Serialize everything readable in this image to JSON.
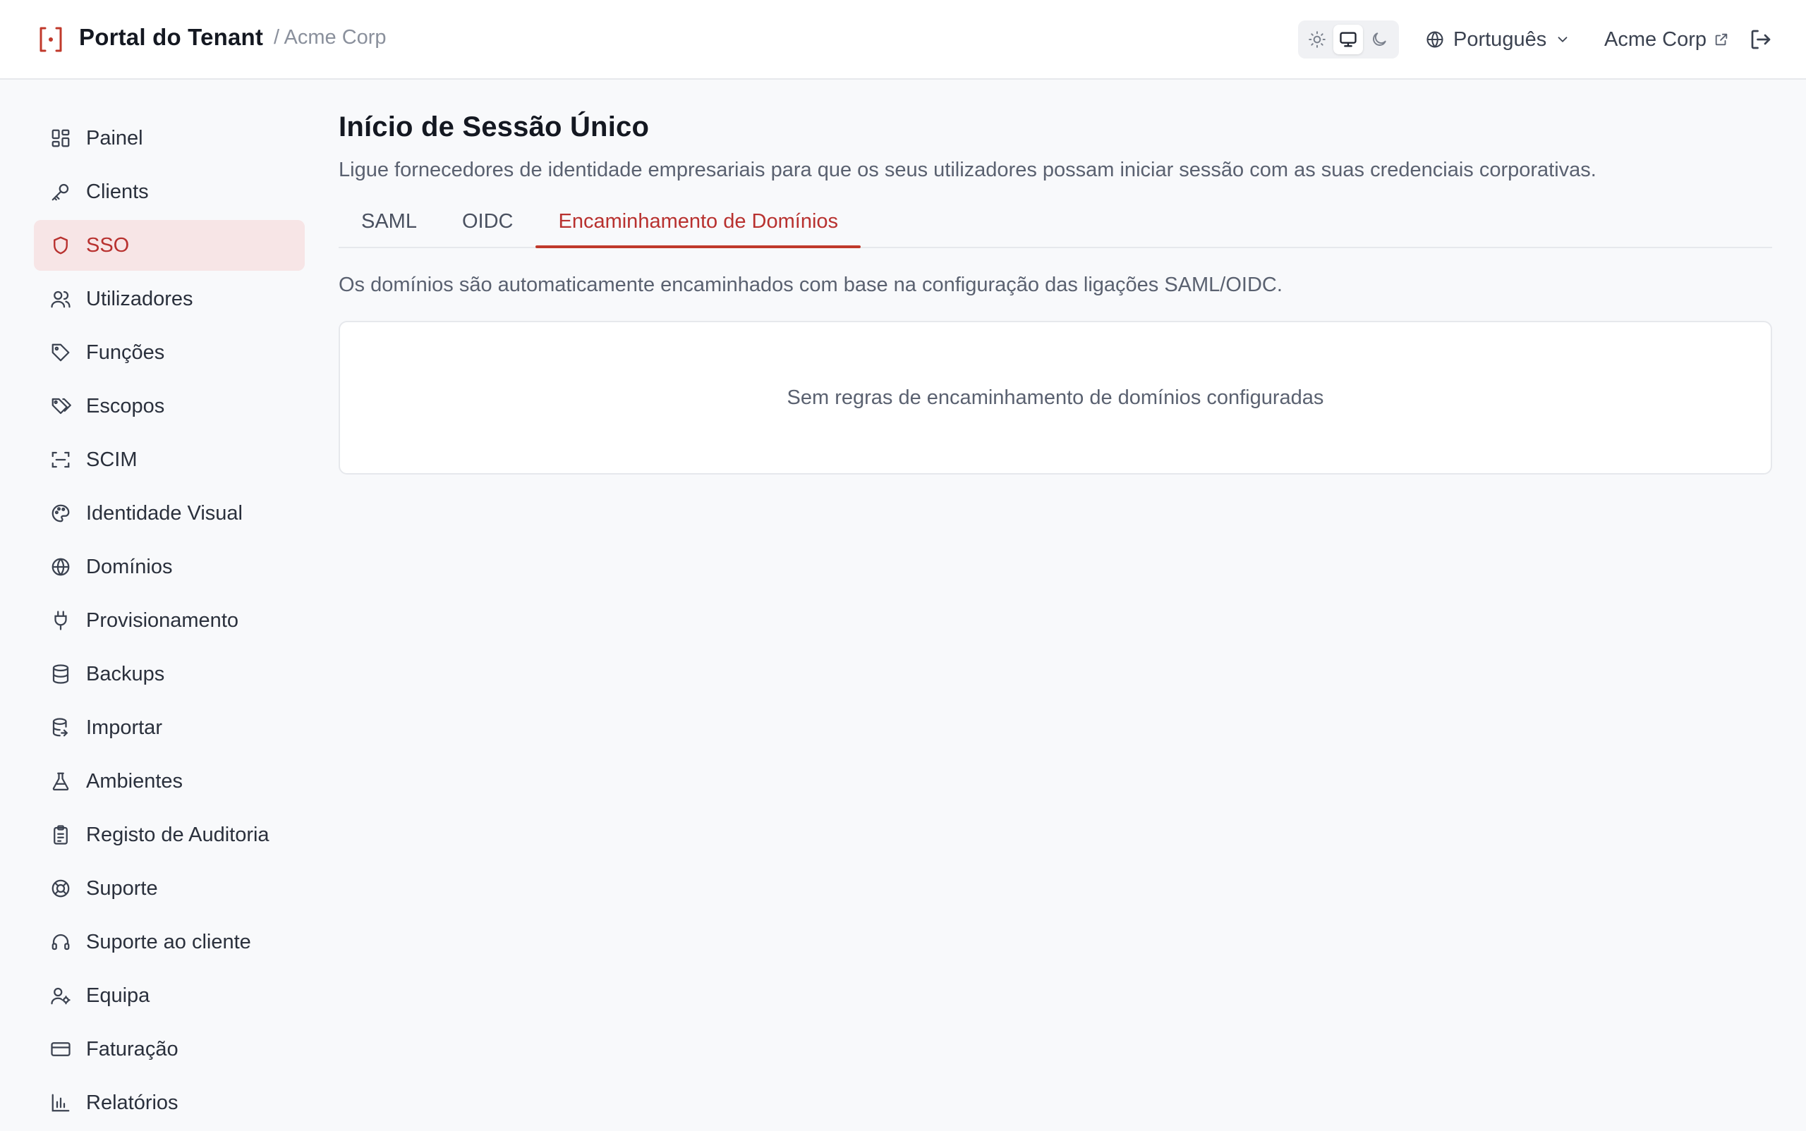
{
  "header": {
    "title": "Portal do Tenant",
    "tenant_crumb": "/ Acme Corp",
    "language": "Português",
    "tenant_link": "Acme Corp"
  },
  "sidebar": {
    "items": [
      {
        "label": "Painel",
        "icon": "dashboard-icon"
      },
      {
        "label": "Clients",
        "icon": "key-icon"
      },
      {
        "label": "SSO",
        "icon": "shield-icon",
        "active": true
      },
      {
        "label": "Utilizadores",
        "icon": "users-icon"
      },
      {
        "label": "Funções",
        "icon": "tag-icon"
      },
      {
        "label": "Escopos",
        "icon": "tags-icon"
      },
      {
        "label": "SCIM",
        "icon": "scan-icon"
      },
      {
        "label": "Identidade Visual",
        "icon": "palette-icon"
      },
      {
        "label": "Domínios",
        "icon": "globe-icon"
      },
      {
        "label": "Provisionamento",
        "icon": "plug-icon"
      },
      {
        "label": "Backups",
        "icon": "database-icon"
      },
      {
        "label": "Importar",
        "icon": "database-import-icon"
      },
      {
        "label": "Ambientes",
        "icon": "flask-icon"
      },
      {
        "label": "Registo de Auditoria",
        "icon": "clipboard-icon"
      },
      {
        "label": "Suporte",
        "icon": "lifebuoy-icon"
      },
      {
        "label": "Suporte ao cliente",
        "icon": "headset-icon"
      },
      {
        "label": "Equipa",
        "icon": "user-cog-icon"
      },
      {
        "label": "Faturação",
        "icon": "credit-card-icon"
      },
      {
        "label": "Relatórios",
        "icon": "bar-chart-icon"
      }
    ]
  },
  "main": {
    "title": "Início de Sessão Único",
    "description": "Ligue fornecedores de identidade empresariais para que os seus utilizadores possam iniciar sessão com as suas credenciais corporativas.",
    "tabs": [
      {
        "label": "SAML"
      },
      {
        "label": "OIDC"
      },
      {
        "label": "Encaminhamento de Domínios",
        "active": true
      }
    ],
    "routing_note": "Os domínios são automaticamente encaminhados com base na configuração das ligações SAML/OIDC.",
    "empty_state": "Sem regras de encaminhamento de domínios configuradas"
  },
  "colors": {
    "accent": "#b8312f",
    "active_bg": "#f7e5e6",
    "border": "#e6e8ec"
  }
}
